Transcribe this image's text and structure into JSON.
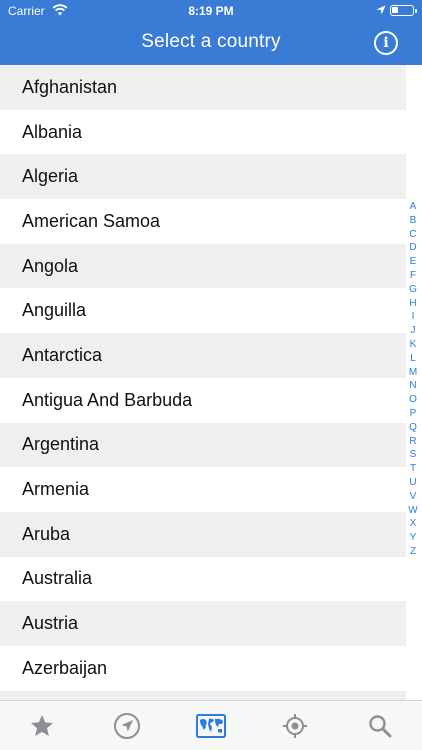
{
  "status_bar": {
    "carrier": "Carrier",
    "time": "8:19 PM"
  },
  "header": {
    "title": "Select a country",
    "info_glyph": "i",
    "background": "#3a7bd5"
  },
  "countries": [
    "Afghanistan",
    "Albania",
    "Algeria",
    "American Samoa",
    "Angola",
    "Anguilla",
    "Antarctica",
    "Antigua And Barbuda",
    "Argentina",
    "Armenia",
    "Aruba",
    "Australia",
    "Austria",
    "Azerbaijan"
  ],
  "index_letters": [
    "A",
    "B",
    "C",
    "D",
    "E",
    "F",
    "G",
    "H",
    "I",
    "J",
    "K",
    "L",
    "M",
    "N",
    "O",
    "P",
    "Q",
    "R",
    "S",
    "T",
    "U",
    "V",
    "W",
    "X",
    "Y",
    "Z"
  ],
  "tabs": [
    {
      "icon": "star-icon",
      "selected": false
    },
    {
      "icon": "navigation-arrow-icon",
      "selected": false
    },
    {
      "icon": "world-map-icon",
      "selected": true
    },
    {
      "icon": "crosshair-icon",
      "selected": false
    },
    {
      "icon": "search-icon",
      "selected": false
    }
  ],
  "colors": {
    "accent": "#2a7de1",
    "tab_inactive": "#8e8e93",
    "row_alt": "#efefef"
  }
}
